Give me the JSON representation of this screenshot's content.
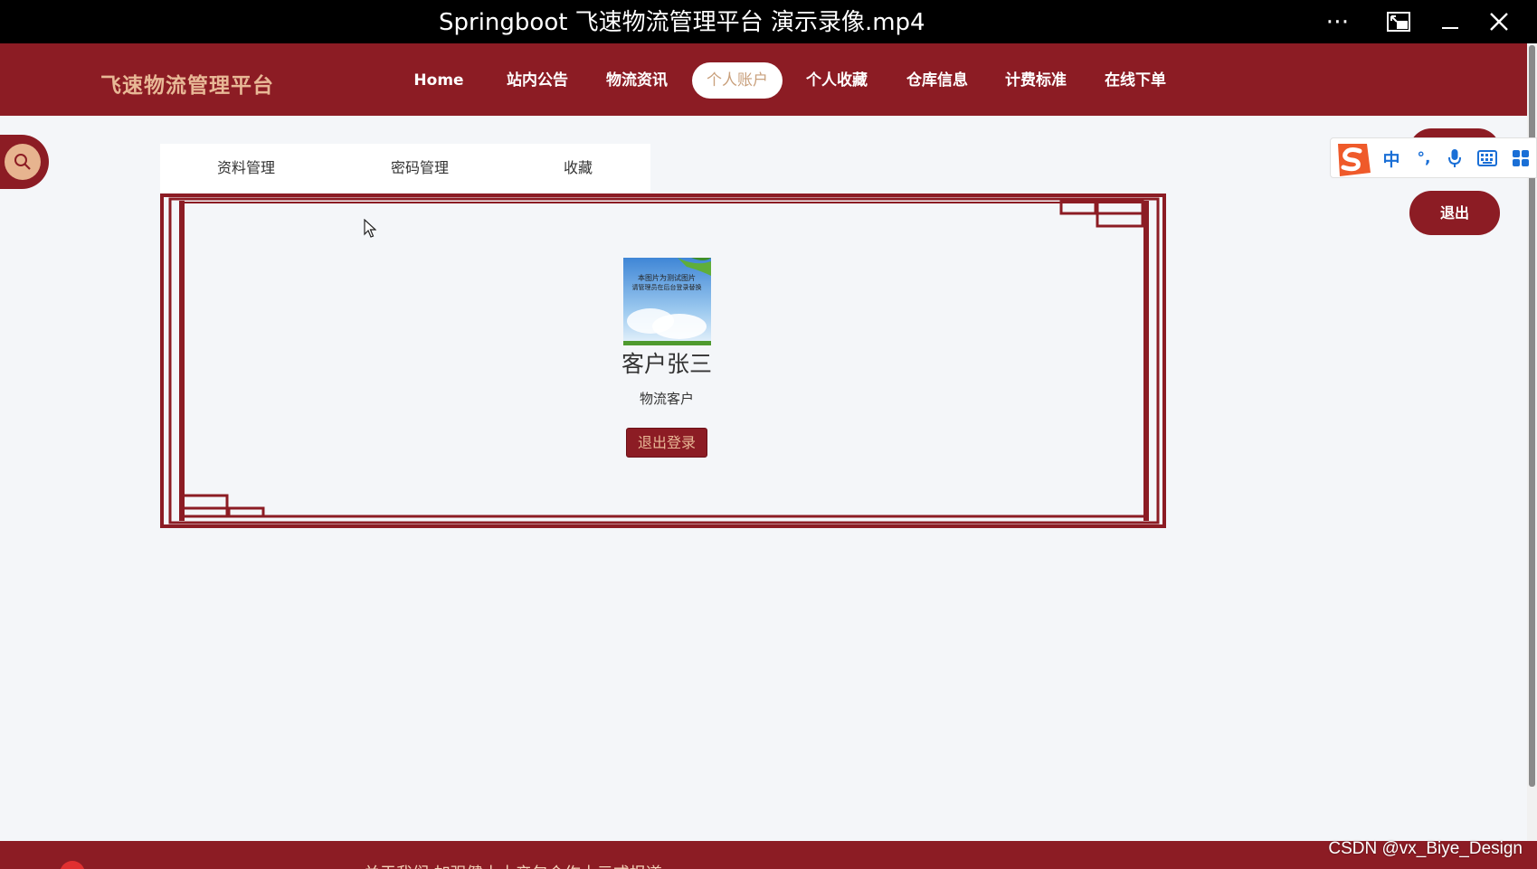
{
  "player": {
    "title": "Springboot 飞速物流管理平台 演示录像.mp4"
  },
  "site": {
    "title": "飞速物流管理平台"
  },
  "nav": {
    "items": [
      {
        "label": "Home"
      },
      {
        "label": "站内公告"
      },
      {
        "label": "物流资讯"
      },
      {
        "label": "个人账户"
      },
      {
        "label": "个人收藏"
      },
      {
        "label": "仓库信息"
      },
      {
        "label": "计费标准"
      },
      {
        "label": "在线下单"
      }
    ],
    "active_index": 3
  },
  "tabs": [
    {
      "label": "资料管理"
    },
    {
      "label": "密码管理"
    },
    {
      "label": "收藏"
    }
  ],
  "profile": {
    "avatar_caption_line1": "本图片为测试图片",
    "avatar_caption_line2": "请管理员在后台登录替换",
    "name": "客户张三",
    "role": "物流客户",
    "logout_label": "退出登录"
  },
  "right": {
    "logout_label": "退出"
  },
  "ime": {
    "chinese_label": "中",
    "punct_label": "°,"
  },
  "footer": {
    "text": "关于我们 加强健士土产包合作十元或报道"
  },
  "watermark": "CSDN @vx_Biye_Design",
  "colors": {
    "brand": "#8c1c24",
    "accent": "#e8b896",
    "ime_blue": "#1a6fd6",
    "ime_orange": "#ef5a2a"
  }
}
